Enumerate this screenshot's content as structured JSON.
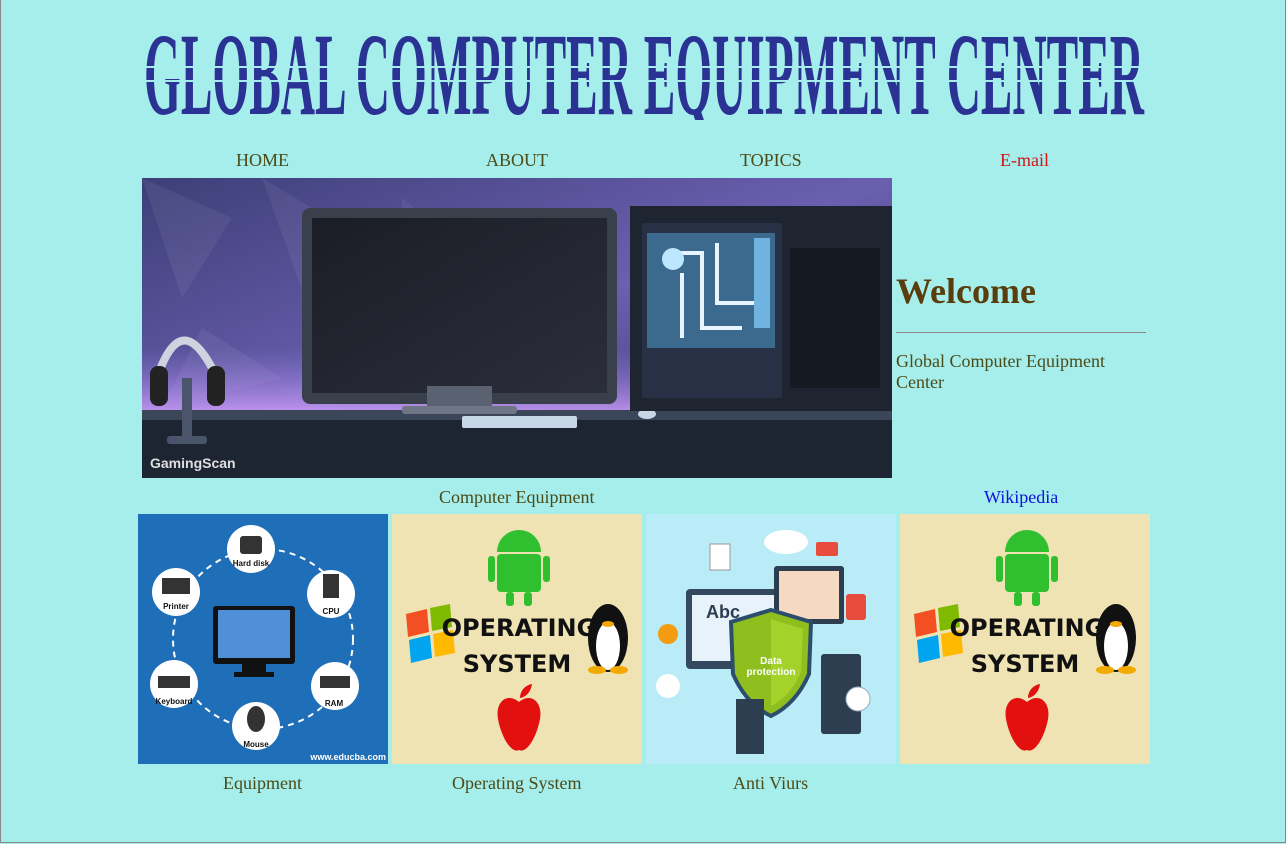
{
  "banner": {
    "title": "GLOBAL COMPUTER EQUIPMENT CENTER"
  },
  "nav": {
    "home": "HOME",
    "about": "ABOUT",
    "topics": "TOPICS",
    "email": "E-mail"
  },
  "hero": {
    "watermark_left": "Gaming",
    "watermark_right": "Scan"
  },
  "welcome": {
    "heading": "Welcome",
    "text": "Global Computer Equipment Center"
  },
  "section": {
    "title": "Computer Equipment",
    "wiki_link": "Wikipedia"
  },
  "tiles": [
    {
      "caption": "Equipment",
      "parts": [
        "Hard disk",
        "CPU",
        "RAM",
        "Mouse",
        "Keyboard",
        "Printer"
      ],
      "credit": "www.educba.com"
    },
    {
      "caption": "Operating System",
      "line1": "OPERATING",
      "line2": "SYSTEM"
    },
    {
      "caption": "Anti Viurs",
      "shield_line1": "Data",
      "shield_line2": "protection",
      "abc": "Abc"
    },
    {
      "caption": "",
      "line1": "OPERATING",
      "line2": "SYSTEM"
    }
  ],
  "colors": {
    "background": "#a5eeec",
    "banner": "#2a3394",
    "email_link": "#d11414",
    "wiki_link": "#1010e0",
    "heading": "#5a3d0c"
  }
}
